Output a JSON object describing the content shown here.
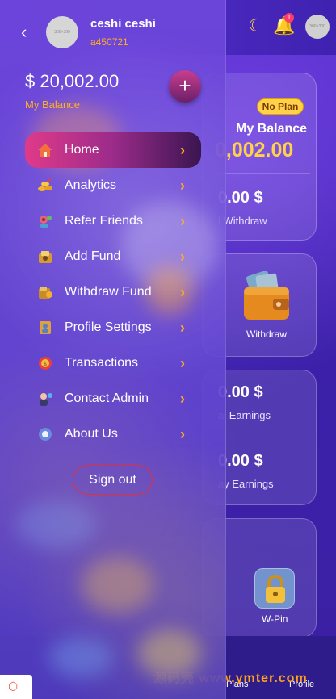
{
  "drawer": {
    "user": {
      "name": "ceshi ceshi",
      "id": "a450721",
      "avatar_placeholder": "300×300"
    },
    "balance": {
      "amount": "$ 20,002.00",
      "label": "My Balance"
    },
    "menu": [
      {
        "label": "Home",
        "icon": "home-icon",
        "active": true
      },
      {
        "label": "Analytics",
        "icon": "coins-icon",
        "active": false
      },
      {
        "label": "Refer Friends",
        "icon": "refer-icon",
        "active": false
      },
      {
        "label": "Add Fund",
        "icon": "add-fund-icon",
        "active": false
      },
      {
        "label": "Withdraw Fund",
        "icon": "withdraw-icon",
        "active": false
      },
      {
        "label": "Profile Settings",
        "icon": "profile-settings-icon",
        "active": false
      },
      {
        "label": "Transactions",
        "icon": "transactions-icon",
        "active": false
      },
      {
        "label": "Contact Admin",
        "icon": "contact-admin-icon",
        "active": false
      },
      {
        "label": "About Us",
        "icon": "about-icon",
        "active": false
      }
    ],
    "signout_label": "Sign out"
  },
  "background": {
    "avatar_placeholder": "300×300",
    "bell_badge": "1",
    "plan_badge": "No Plan",
    "my_balance_label": "My Balance",
    "balance_amount": "0,002.00",
    "total_withdraw_value": "0.00 $",
    "total_withdraw_label": "l Withdraw",
    "withdraw_label": "Withdraw",
    "total_earnings_value": "0.00 $",
    "total_earnings_label": "al Earnings",
    "today_earnings_value": "0.00 $",
    "today_earnings_label": "ay Earnings",
    "wpin_label": "W-Pin",
    "nav_plans": "Plans",
    "nav_profile": "Profile",
    "watermark": "源码壳 www.ymter.com"
  },
  "colors": {
    "accent_orange": "#ffb020",
    "active_gradient_start": "#e03a8a",
    "signout_border": "#e03040"
  }
}
